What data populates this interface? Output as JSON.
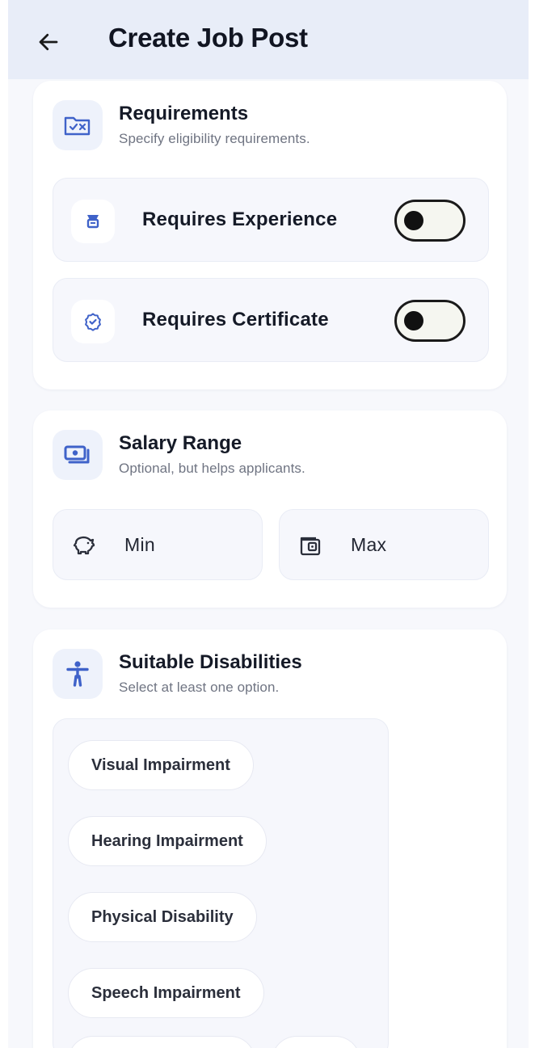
{
  "app_bar": {
    "title": "Create Job Post",
    "back_icon": "arrow-left-icon"
  },
  "requirements": {
    "title": "Requirements",
    "subtitle": "Specify eligibility requirements.",
    "icon": "folder-check-icon",
    "toggles": [
      {
        "label": "Requires Experience",
        "icon": "briefcase-icon",
        "enabled": false
      },
      {
        "label": "Requires Certificate",
        "icon": "badge-check-icon",
        "enabled": false
      }
    ]
  },
  "salary": {
    "title": "Salary Range",
    "subtitle": "Optional, but helps applicants.",
    "icon": "money-icon",
    "min_label": "Min",
    "max_label": "Max"
  },
  "disabilities": {
    "title": "Suitable Disabilities",
    "subtitle": "Select at least one option.",
    "icon": "accessibility-icon",
    "options": [
      "Visual Impairment",
      "Hearing Impairment",
      "Physical Disability",
      "Speech Impairment"
    ]
  },
  "colors": {
    "accent": "#3f62c9",
    "app_bar": "#e8edf8",
    "card": "#ffffff",
    "page": "#f7f8fc"
  }
}
